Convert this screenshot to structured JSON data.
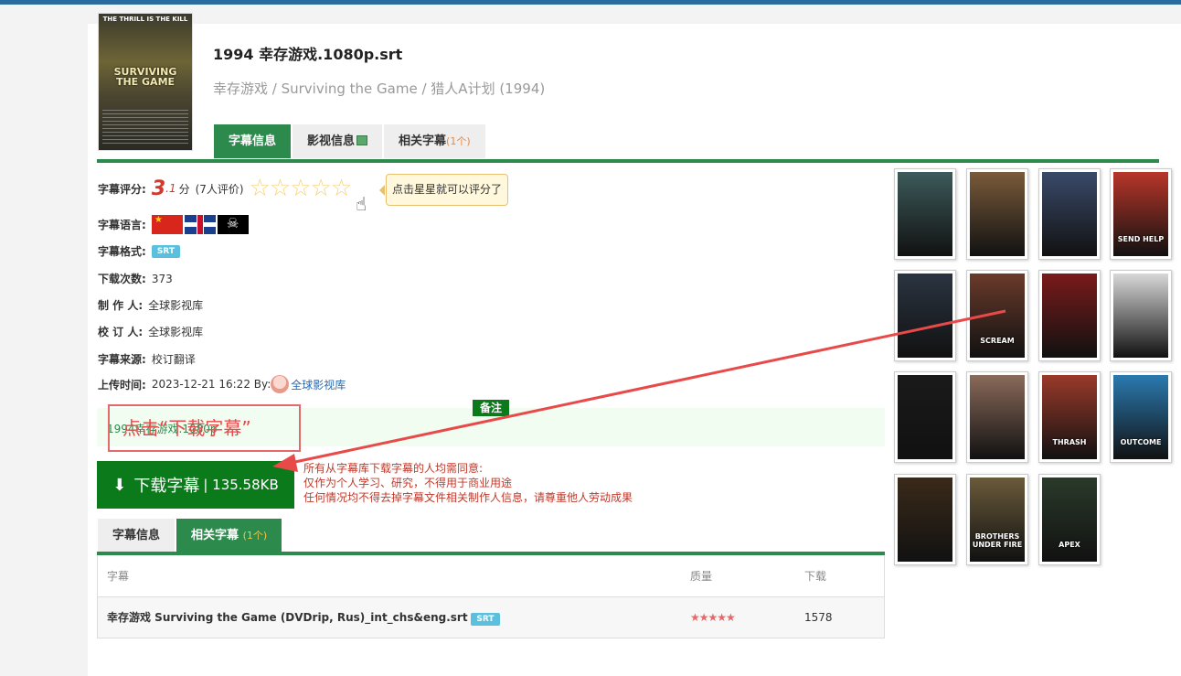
{
  "movie": {
    "title": "1994 幸存游戏.1080p.srt",
    "subtitle": "幸存游戏 / Surviving the Game / 猎人A计划 (1994)",
    "poster_top_text": "THE THRILL IS THE KILL",
    "poster_title_1": "SURVIVING",
    "poster_title_2": "THE GAME"
  },
  "tabs_top": [
    {
      "label": "字幕信息",
      "active": true
    },
    {
      "label": "影视信息",
      "active": false
    },
    {
      "label": "相关字幕",
      "count": "(1个)",
      "active": false
    }
  ],
  "info": {
    "rating_label": "字幕评分:",
    "rating_int": "3",
    "rating_dec": ".1",
    "rating_unit": "分",
    "rating_count": "(7人评价)",
    "rating_tooltip": "点击星星就可以评分了",
    "language_label": "字幕语言:",
    "format_label": "字幕格式:",
    "format_value": "SRT",
    "downloads_label": "下载次数:",
    "downloads_value": "373",
    "maker_label": "制 作 人:",
    "maker_value": "全球影视库",
    "reviewer_label": "校 订 人:",
    "reviewer_value": "全球影视库",
    "source_label": "字幕来源:",
    "source_value": "校订翻译",
    "upload_label": "上传时间:",
    "upload_value": "2023-12-21 16:22 By:",
    "uploader": "全球影视库"
  },
  "note": {
    "label": "备注",
    "text": "1994幸存游戏.1080p"
  },
  "annotation": {
    "text": "点击“下载字幕”"
  },
  "download": {
    "label": "下载字幕",
    "size": "| 135.58KB"
  },
  "terms": {
    "line1": "所有从字幕库下载字幕的人均需同意:",
    "line2": "仅作为个人学习、研究，不得用于商业用途",
    "line3": "任何情况均不得去掉字幕文件相关制作人信息，请尊重他人劳动成果"
  },
  "tabs_bottom": [
    {
      "label": "字幕信息",
      "active": false
    },
    {
      "label": "相关字幕",
      "count": "(1个)",
      "active": true
    }
  ],
  "table": {
    "headers": {
      "name": "字幕",
      "quality": "质量",
      "downloads": "下载"
    },
    "rows": [
      {
        "name": "幸存游戏 Surviving the Game (DVDrip, Rus)_int_chs&eng.srt",
        "format": "SRT",
        "stars": 5,
        "downloads": "1578"
      }
    ]
  },
  "posters": [
    {
      "label": "",
      "color": "#3d5a5a"
    },
    {
      "label": "",
      "color": "#7a5a3a"
    },
    {
      "label": "",
      "color": "#3a4a6a"
    },
    {
      "label": "SEND HELP",
      "color": "#b8362a"
    },
    {
      "label": "",
      "color": "#2a3440"
    },
    {
      "label": "SCREAM",
      "color": "#6a3a2a"
    },
    {
      "label": "",
      "color": "#7a1a1a"
    },
    {
      "label": "",
      "color": "#d8d8d8"
    },
    {
      "label": "",
      "color": "#1a1a1a"
    },
    {
      "label": "",
      "color": "#8a6a5a"
    },
    {
      "label": "THRASH",
      "color": "#9a3a2a"
    },
    {
      "label": "OUTCOME",
      "color": "#2a7ab0"
    },
    {
      "label": "",
      "color": "#3a2a1a"
    },
    {
      "label": "BROTHERS UNDER FIRE",
      "color": "#6a5a3a"
    },
    {
      "label": "APEX",
      "color": "#2a3a2a"
    }
  ]
}
